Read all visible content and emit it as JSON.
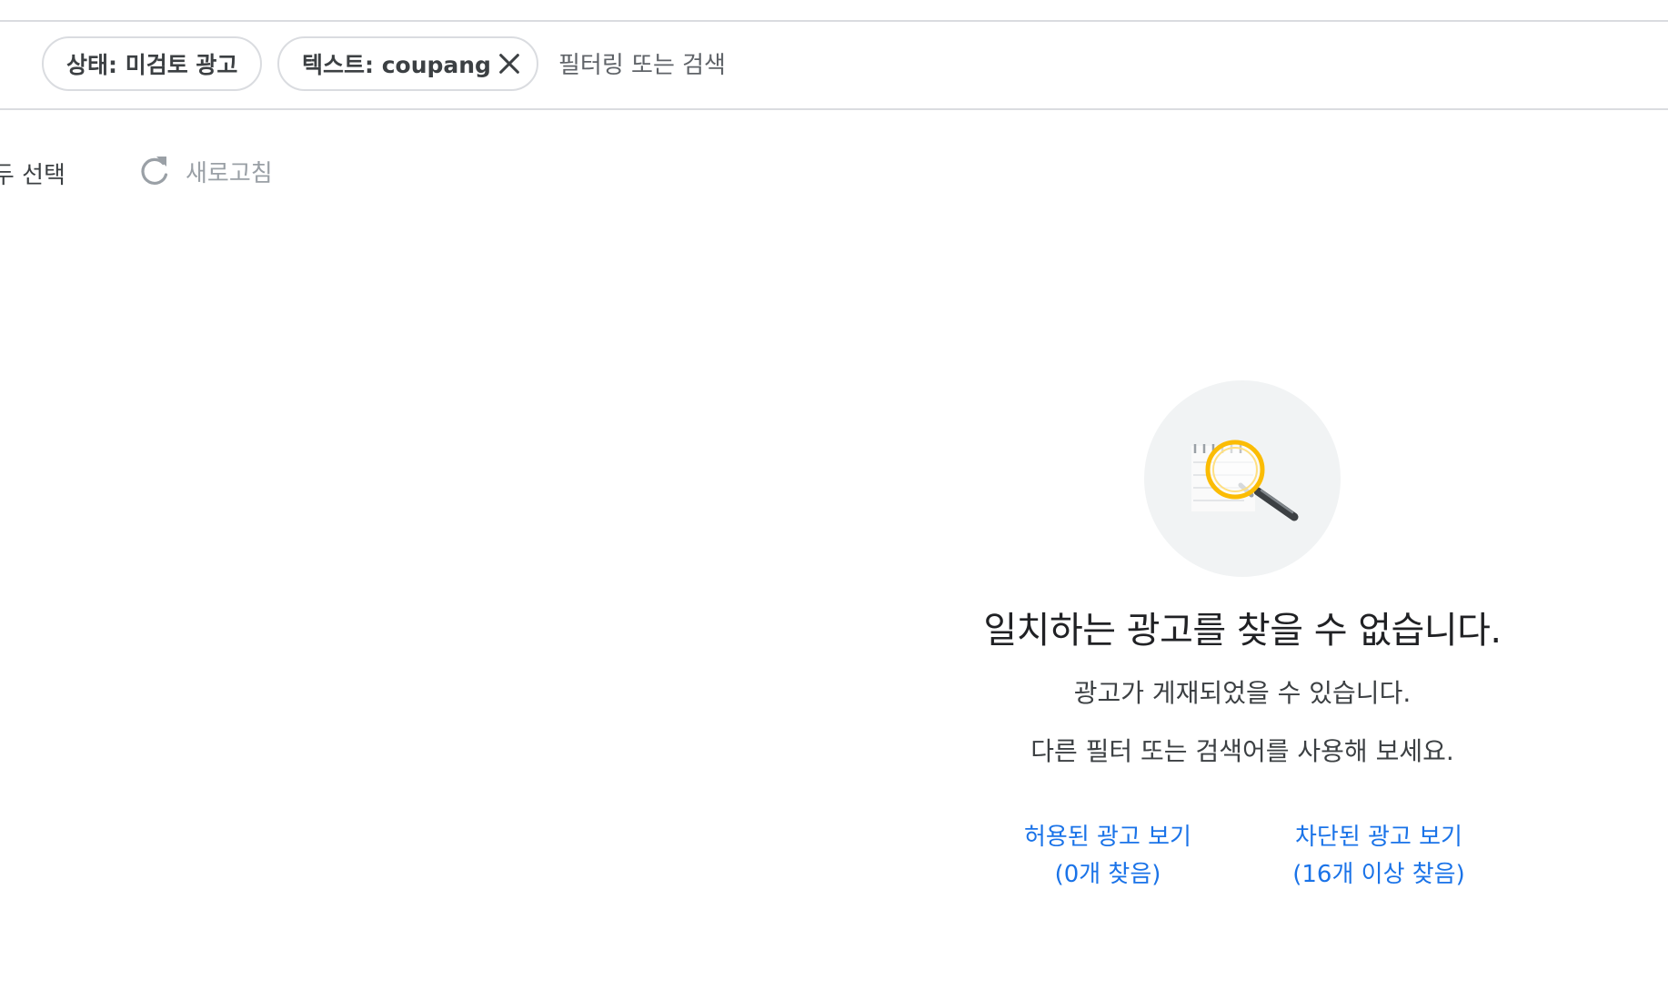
{
  "filter_bar": {
    "chips": [
      {
        "label": "상태: 미검토 광고"
      },
      {
        "label": "텍스트: coupang",
        "removable": true
      }
    ],
    "search_placeholder": "필터링 또는 검색"
  },
  "toolbar": {
    "select_all_label": "모두 선택",
    "refresh_label": "새로고침",
    "refresh_icon": "refresh-icon"
  },
  "empty_state": {
    "illustration_icon": "magnifier-search-icon",
    "title": "일치하는 광고를 찾을 수 없습니다.",
    "subtitle_line1": "광고가 게재되었을 수 있습니다.",
    "subtitle_line2": "다른 필터 또는 검색어를 사용해 보세요.",
    "links": [
      {
        "line1": "허용된 광고 보기",
        "line2": "(0개 찾음)"
      },
      {
        "line1": "차단된 광고 보기",
        "line2": "(16개 이상 찾음)"
      }
    ]
  },
  "colors": {
    "link": "#1a73e8",
    "chip_border": "#dadce0",
    "divider": "#dadce0",
    "text_primary": "#202124",
    "text_secondary": "#3c4043",
    "text_disabled": "#9aa0a6",
    "illustration_bg": "#f1f3f4",
    "magnifier_ring": "#fbbc04"
  }
}
